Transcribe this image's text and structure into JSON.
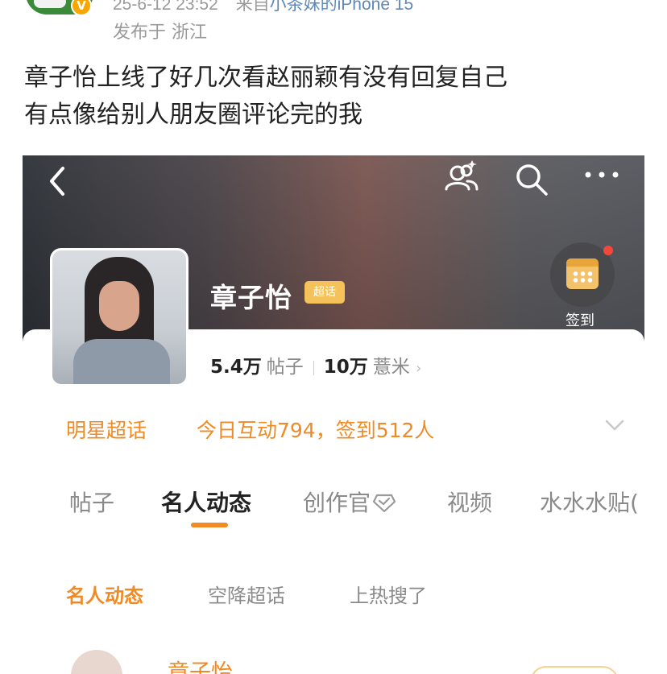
{
  "post": {
    "timestamp": "25-6-12 23:52",
    "from_label": "来自",
    "device": "小茶妹的iPhone 15",
    "location": "发布于 浙江",
    "text_line1": "章子怡上线了好几次看赵丽颖有没有回复自己",
    "text_line2": "有点像给别人朋友圈评论完的我",
    "verified_badge": "V"
  },
  "screenshot": {
    "profile": {
      "name": "章子怡",
      "badge": "超话",
      "checkin_label": "签到",
      "posts_count": "5.4万",
      "posts_label": "帖子",
      "fans_count": "10万",
      "fans_label": "薏米",
      "fans_chevron": "›"
    },
    "info_row": {
      "category": "明星超话",
      "activity": "今日互动794，签到512人"
    },
    "tabs": [
      {
        "label": "帖子"
      },
      {
        "label": "名人动态"
      },
      {
        "label": "创作官"
      },
      {
        "label": "视频"
      },
      {
        "label": "水水水贴("
      }
    ],
    "subtabs": [
      {
        "label": "名人动态"
      },
      {
        "label": "空降超话"
      },
      {
        "label": "上热搜了"
      }
    ],
    "feed": {
      "author": "章子怡"
    }
  },
  "colors": {
    "accent": "#f08a24",
    "link": "#5f87b8",
    "muted": "#9a9a9a"
  },
  "icons": [
    "back-icon",
    "people-icon",
    "search-icon",
    "more-icon",
    "calendar-icon",
    "chevron-down-icon"
  ]
}
